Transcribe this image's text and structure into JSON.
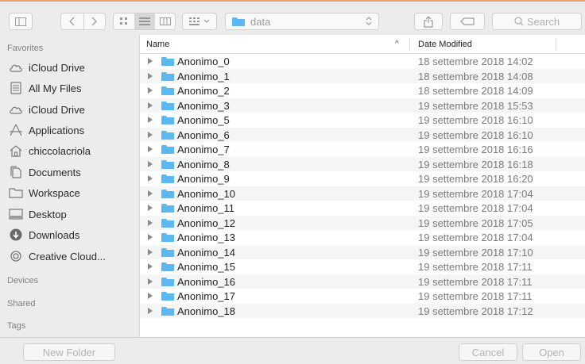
{
  "toolbar": {
    "path_label": "data",
    "search_placeholder": "Search"
  },
  "sidebar": {
    "sections": {
      "favorites": "Favorites",
      "devices": "Devices",
      "shared": "Shared",
      "tags": "Tags"
    },
    "items": [
      {
        "label": "iCloud Drive",
        "icon": "cloud-icon"
      },
      {
        "label": "All My Files",
        "icon": "all-files-icon"
      },
      {
        "label": "iCloud Drive",
        "icon": "cloud-icon"
      },
      {
        "label": "Applications",
        "icon": "applications-icon"
      },
      {
        "label": "chiccolacriola",
        "icon": "home-icon"
      },
      {
        "label": "Documents",
        "icon": "documents-icon"
      },
      {
        "label": "Workspace",
        "icon": "folder-icon"
      },
      {
        "label": "Desktop",
        "icon": "desktop-icon"
      },
      {
        "label": "Downloads",
        "icon": "downloads-icon"
      },
      {
        "label": "Creative Cloud...",
        "icon": "creative-cloud-icon"
      }
    ]
  },
  "list": {
    "columns": {
      "name": "Name",
      "date": "Date Modified"
    },
    "rows": [
      {
        "name": "Anonimo_0",
        "date": "18 settembre 2018 14:02"
      },
      {
        "name": "Anonimo_1",
        "date": "18 settembre 2018 14:08"
      },
      {
        "name": "Anonimo_2",
        "date": "18 settembre 2018 14:09"
      },
      {
        "name": "Anonimo_3",
        "date": "19 settembre 2018 15:53"
      },
      {
        "name": "Anonimo_5",
        "date": "19 settembre 2018 16:10"
      },
      {
        "name": "Anonimo_6",
        "date": "19 settembre 2018 16:10"
      },
      {
        "name": "Anonimo_7",
        "date": "19 settembre 2018 16:16"
      },
      {
        "name": "Anonimo_8",
        "date": "19 settembre 2018 16:18"
      },
      {
        "name": "Anonimo_9",
        "date": "19 settembre 2018 16:20"
      },
      {
        "name": "Anonimo_10",
        "date": "19 settembre 2018 17:04"
      },
      {
        "name": "Anonimo_11",
        "date": "19 settembre 2018 17:04"
      },
      {
        "name": "Anonimo_12",
        "date": "19 settembre 2018 17:05"
      },
      {
        "name": "Anonimo_13",
        "date": "19 settembre 2018 17:04"
      },
      {
        "name": "Anonimo_14",
        "date": "19 settembre 2018 17:10"
      },
      {
        "name": "Anonimo_15",
        "date": "19 settembre 2018 17:11"
      },
      {
        "name": "Anonimo_16",
        "date": "19 settembre 2018 17:11"
      },
      {
        "name": "Anonimo_17",
        "date": "19 settembre 2018 17:11"
      },
      {
        "name": "Anonimo_18",
        "date": "19 settembre 2018 17:12"
      }
    ]
  },
  "buttons": {
    "new_folder": "New Folder",
    "cancel": "Cancel",
    "open": "Open"
  },
  "colors": {
    "folder": "#5bb8f0",
    "accent_line": "#e9a06a"
  }
}
